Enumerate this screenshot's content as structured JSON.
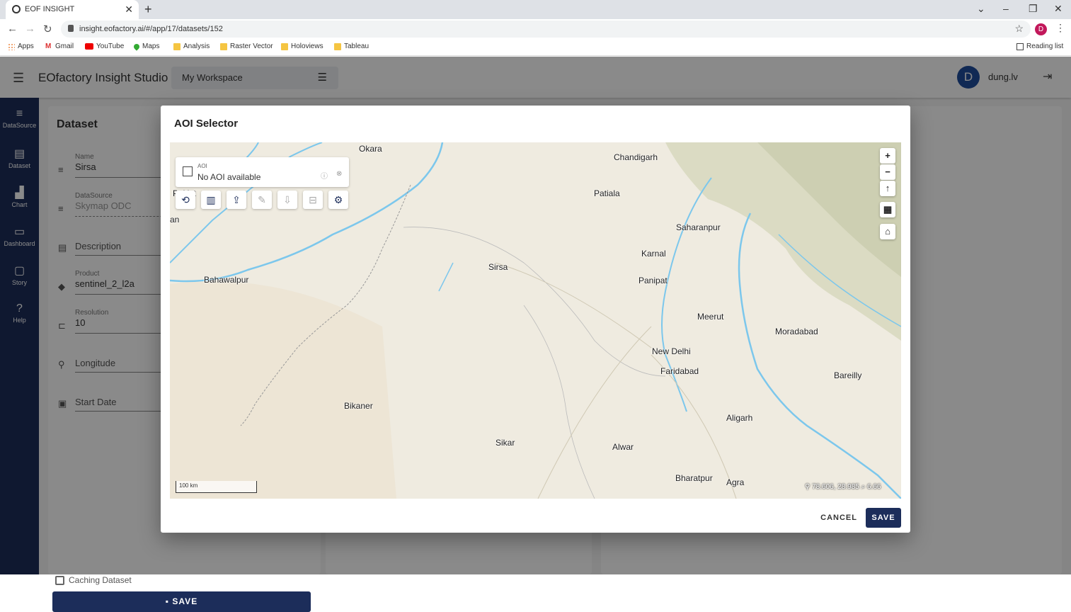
{
  "browser": {
    "tab_title": "EOF INSIGHT",
    "tab_close": "✕",
    "new_tab": "+",
    "url": "insight.eofactory.ai/#/app/17/datasets/152",
    "profile_initial": "D",
    "bookmarks": [
      {
        "label": "Apps",
        "icon": "apps-grid-icon"
      },
      {
        "label": "Gmail",
        "icon": "gmail-icon"
      },
      {
        "label": "YouTube",
        "icon": "youtube-icon"
      },
      {
        "label": "Maps",
        "icon": "maps-icon"
      },
      {
        "label": "Analysis",
        "icon": "folder-icon"
      },
      {
        "label": "Raster Vector",
        "icon": "folder-icon"
      },
      {
        "label": "Holoviews",
        "icon": "folder-icon"
      },
      {
        "label": "Tableau",
        "icon": "folder-icon"
      }
    ],
    "reading_list": "Reading list"
  },
  "app": {
    "title": "EOfactory Insight Studio",
    "workspace": "My Workspace",
    "user": {
      "initial": "D",
      "name": "dung.lv"
    },
    "nav": [
      {
        "label": "DataSource",
        "icon": "database-icon"
      },
      {
        "label": "Dataset",
        "icon": "document-icon"
      },
      {
        "label": "Chart",
        "icon": "bar-chart-icon"
      },
      {
        "label": "Dashboard",
        "icon": "dashboard-icon"
      },
      {
        "label": "Story",
        "icon": "presentation-icon"
      },
      {
        "label": "Help",
        "icon": "help-icon"
      }
    ]
  },
  "dataset_panel": {
    "title": "Dataset",
    "name_label": "Name",
    "name_value": "Sirsa",
    "datasource_label": "DataSource",
    "datasource_value": "Skymap ODC",
    "description_placeholder": "Description",
    "product_label": "Product",
    "product_value": "sentinel_2_l2a",
    "resolution_label": "Resolution",
    "resolution_value": "10",
    "longitude_placeholder": "Longitude",
    "start_date_placeholder": "Start Date",
    "caching_label": "Caching Dataset",
    "save_label": "SAVE"
  },
  "dialog": {
    "title": "AOI Selector",
    "aoi_label": "AOI",
    "aoi_value": "No AOI available",
    "cancel_label": "CANCEL",
    "save_label": "SAVE",
    "map": {
      "scale": "100 km",
      "coords": "⚲ 78.606, 28.985  ⌕ 6.66",
      "cut_off_label_1": "Pakist",
      "cut_off_label_2": "an",
      "places": [
        {
          "name": "Okara"
        },
        {
          "name": "Chandigarh"
        },
        {
          "name": "Patiala"
        },
        {
          "name": "Saharanpur"
        },
        {
          "name": "Karnal"
        },
        {
          "name": "Sirsa"
        },
        {
          "name": "Panipat"
        },
        {
          "name": "Bahawalpur"
        },
        {
          "name": "Meerut"
        },
        {
          "name": "Moradabad"
        },
        {
          "name": "New Delhi"
        },
        {
          "name": "Faridabad"
        },
        {
          "name": "Bareilly"
        },
        {
          "name": "Bikaner"
        },
        {
          "name": "Aligarh"
        },
        {
          "name": "Sikar"
        },
        {
          "name": "Alwar"
        },
        {
          "name": "Bharatpur"
        },
        {
          "name": "Agra"
        }
      ]
    }
  }
}
